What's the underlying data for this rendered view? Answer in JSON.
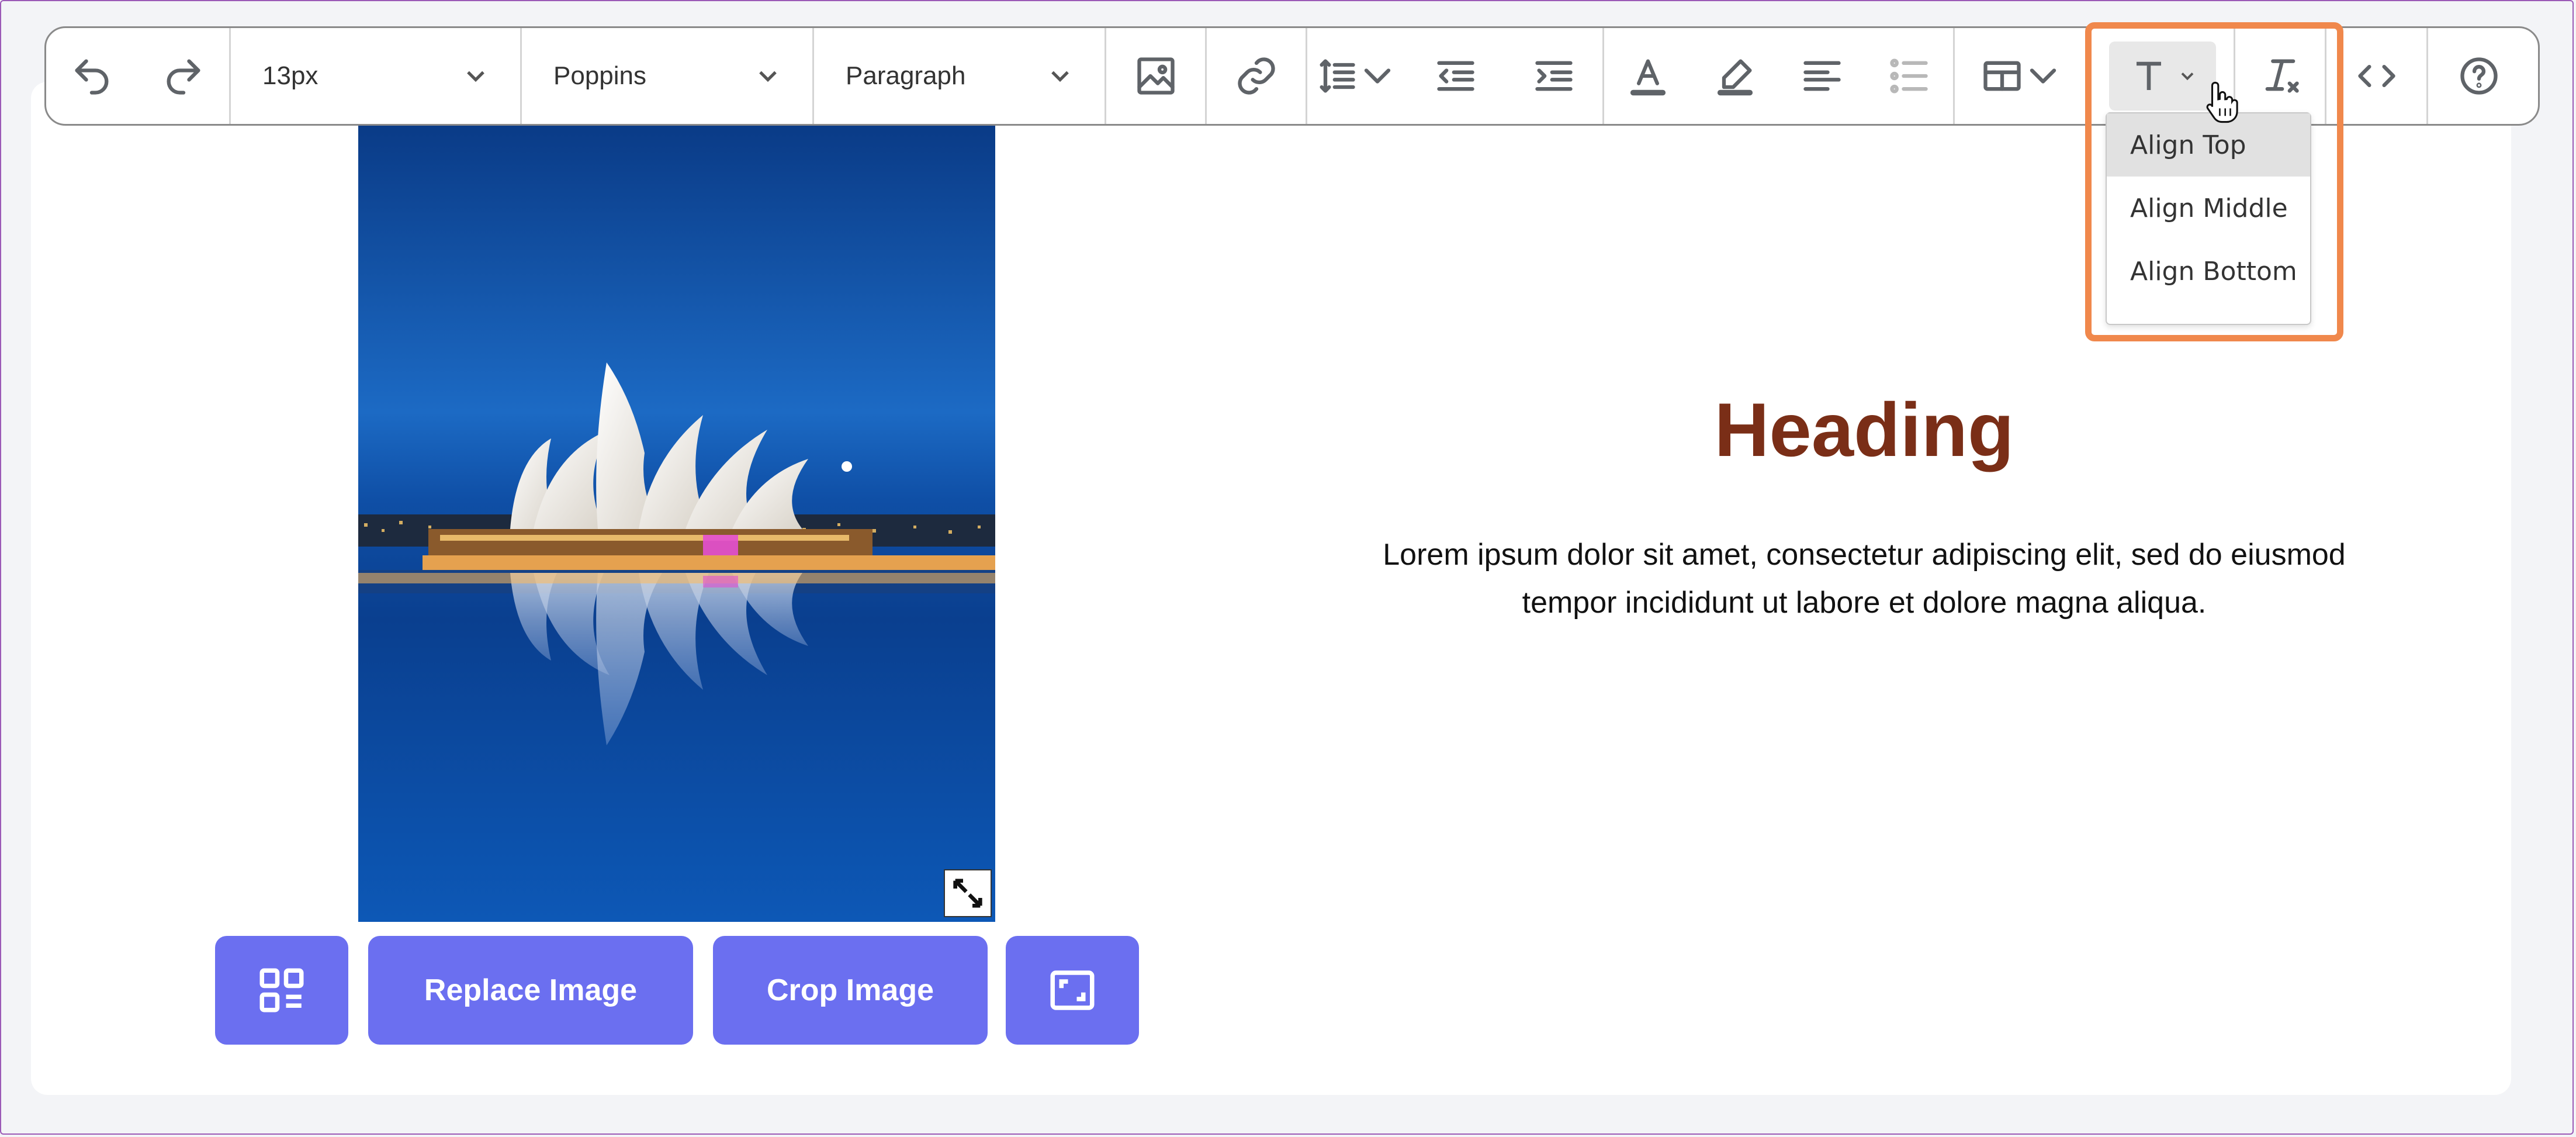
{
  "toolbar": {
    "font_size": "13px",
    "font_family": "Poppins",
    "block_format": "Paragraph"
  },
  "vertical_align_menu": {
    "items": [
      {
        "label": "Align Top",
        "active": true
      },
      {
        "label": "Align Middle",
        "active": false
      },
      {
        "label": "Align Bottom",
        "active": false
      }
    ]
  },
  "image_actions": {
    "replace_label": "Replace Image",
    "crop_label": "Crop Image"
  },
  "content": {
    "heading": "Heading",
    "paragraph": "Lorem ipsum dolor sit amet, consectetur adipiscing elit, sed do eiusmod tempor incididunt ut labore et dolore magna aliqua."
  },
  "colors": {
    "accent_button": "#6b6ff0",
    "heading": "#7a2e17",
    "highlight_frame": "#f0884c"
  }
}
